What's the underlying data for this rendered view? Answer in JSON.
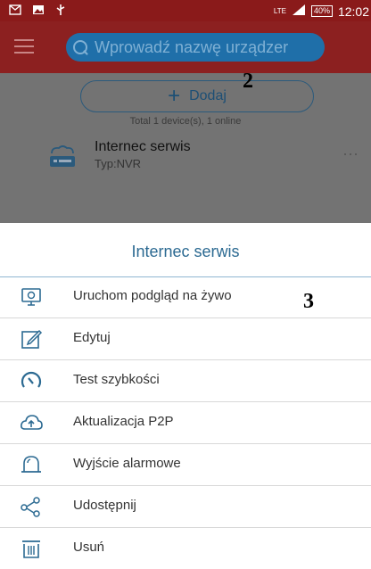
{
  "status_bar": {
    "lte": "LTE",
    "battery": "40%",
    "time": "12:02"
  },
  "header": {
    "search_placeholder": "Wprowadź nazwę urządzer"
  },
  "device_list": {
    "add_label": "Dodaj",
    "total_text": "Total 1 device(s), 1 online",
    "devices": [
      {
        "name": "Internec serwis",
        "type": "Typ:NVR",
        "more": "···"
      }
    ]
  },
  "annotations": {
    "marker_2": "2",
    "marker_3": "3"
  },
  "sheet": {
    "title": "Internec serwis",
    "items": [
      {
        "label": "Uruchom podgląd na żywo",
        "icon": "monitor-icon"
      },
      {
        "label": "Edytuj",
        "icon": "edit-icon"
      },
      {
        "label": "Test szybkości",
        "icon": "speedometer-icon"
      },
      {
        "label": "Aktualizacja P2P",
        "icon": "cloud-upload-icon"
      },
      {
        "label": "Wyjście alarmowe",
        "icon": "alarm-icon"
      },
      {
        "label": "Udostępnij",
        "icon": "share-icon"
      },
      {
        "label": "Usuń",
        "icon": "trash-icon"
      }
    ]
  },
  "colors": {
    "accent": "#2c6a92",
    "header": "#8c2020",
    "icon": "#2c6a92"
  }
}
